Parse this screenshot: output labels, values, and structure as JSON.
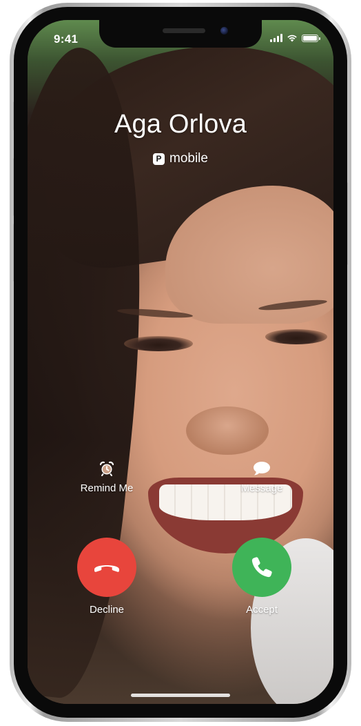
{
  "status_bar": {
    "time": "9:41",
    "signal_icon": "cellular-signal-icon",
    "wifi_icon": "wifi-icon",
    "battery_icon": "battery-icon",
    "battery_level": 1.0
  },
  "caller": {
    "name": "Aga Orlova",
    "badge_letter": "P",
    "line_label": "mobile"
  },
  "secondary_actions": {
    "remind": {
      "label": "Remind Me",
      "icon": "alarm-clock-icon"
    },
    "message": {
      "label": "Message",
      "icon": "message-bubble-icon"
    }
  },
  "call_actions": {
    "decline": {
      "label": "Decline",
      "icon": "phone-hangup-icon",
      "color": "#e8453c"
    },
    "accept": {
      "label": "Accept",
      "icon": "phone-icon",
      "color": "#3fb458"
    }
  }
}
